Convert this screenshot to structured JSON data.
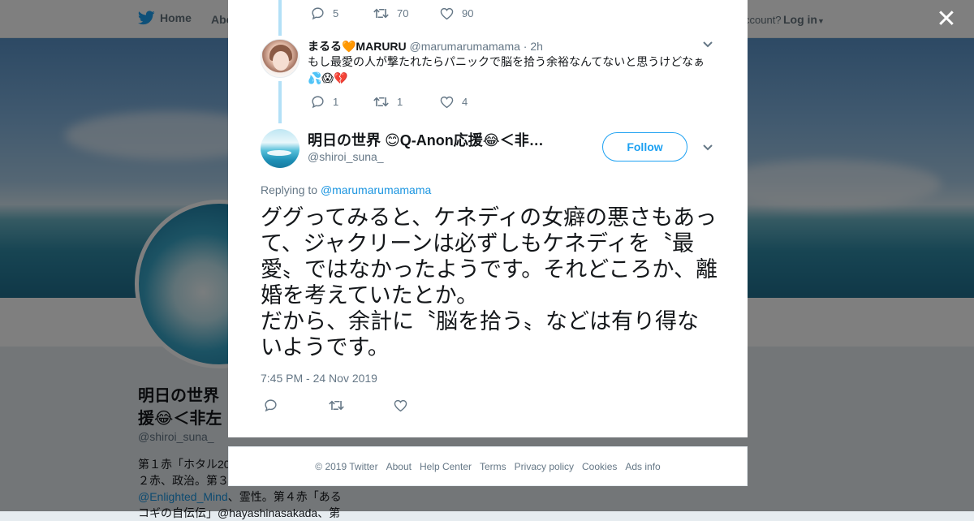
{
  "nav": {
    "home_label": "Home",
    "about_label": "Abo",
    "account_prompt": "ccount?",
    "login_label": "Log in"
  },
  "profile": {
    "name_line1": "明日の世界",
    "name_line2": "援😂＜非左",
    "handle": "@shiroi_suna_",
    "bio_line1": "第１赤「ホタル20",
    "bio_line2": "２赤、政治。第３",
    "bio_link1": "@Enlighted_Mind",
    "bio_line3_rest": "、霊性。第４赤「ある",
    "bio_line4": "コギの自伝伝」@hayashinasakada、第"
  },
  "thread": {
    "prev_tweet_actions": {
      "replies": "5",
      "retweets": "70",
      "likes": "90"
    },
    "reply": {
      "display_name": "まるる🧡MARURU",
      "handle": "@marumarumamama",
      "time": "· 2h",
      "text": "もし最愛の人が撃たれたらパニックで脳を拾う余裕なんてないと思うけどなぁ💦😱💔",
      "actions": {
        "replies": "1",
        "retweets": "1",
        "likes": "4"
      }
    }
  },
  "main_tweet": {
    "display_name": "明日の世界 😊Q-Anon応援😂＜非…",
    "handle": "@shiroi_suna_",
    "follow_label": "Follow",
    "replying_prefix": "Replying to",
    "replying_to": "@marumarumamama",
    "text": "ググってみると、ケネディの女癖の悪さもあって、ジャクリーンは必ずしもケネディを〝最愛〟ではなかったようです。それどころか、離婚を考えていたとか。\nだから、余計に〝脳を拾う〟などは有り得ないようです。",
    "timestamp": "7:45 PM - 24 Nov 2019"
  },
  "footer": {
    "links": [
      "© 2019 Twitter",
      "About",
      "Help Center",
      "Terms",
      "Privacy policy",
      "Cookies",
      "Ads info"
    ]
  },
  "colors": {
    "twitter_blue": "#1da1f2",
    "link_blue": "#1b95e0",
    "muted": "#657786",
    "thread_line": "#b3e0f7"
  }
}
